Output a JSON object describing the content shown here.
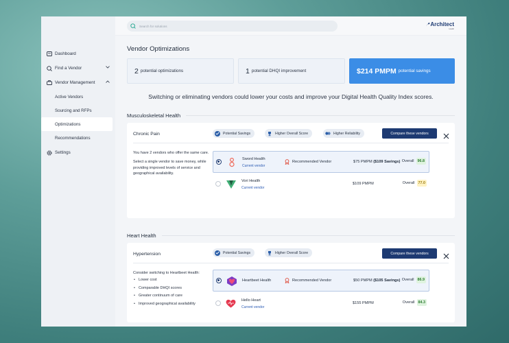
{
  "sidebar": {
    "items": [
      {
        "label": "Dashboard",
        "icon": "dashboard-icon"
      },
      {
        "label": "Find a Vendor",
        "icon": "search-icon"
      },
      {
        "label": "Vendor Management",
        "icon": "briefcase-icon"
      }
    ],
    "sub_items": [
      "Active Vendors",
      "Sourcing and RFPs",
      "Optimizations",
      "Recommendations"
    ],
    "settings_label": "Settings",
    "active_item": "Optimizations"
  },
  "topbar": {
    "search_placeholder": "Search for solutions",
    "logo_text": "Architect",
    "logo_sub": "Health"
  },
  "page": {
    "title": "Vendor Optimizations",
    "stats": [
      {
        "num": "2",
        "label": "potential optimizations"
      },
      {
        "num": "1",
        "label": "potential DHQI improvement"
      },
      {
        "num": "$214 PMPM",
        "label": "potential savings"
      }
    ],
    "subtitle": "Switching or eliminating vendors could lower your costs and improve your Digital Health Quality Index scores."
  },
  "sections": [
    {
      "heading": "Musculoskeletal Health",
      "card": {
        "title": "Chronic Pain",
        "chips": [
          "Potential Savings",
          "Higher Overall Score",
          "Higher Reliability"
        ],
        "compare_label": "Compare these vendors",
        "desc": [
          "You have 2 vendors who offer the same care.",
          "Select a single vendor to save money, while providing improved levels of service and geographical availability."
        ],
        "vendors": [
          {
            "name": "Sword Health",
            "current": "Current vendor",
            "recommended": "Recommended Vendor",
            "price": "$75 PMPM",
            "savings": "($109 Savings)",
            "overall_label": "Overall",
            "score": "96.8"
          },
          {
            "name": "Vori Health",
            "current": "Current vendor",
            "price": "$109 PMPM",
            "overall_label": "Overall",
            "score": "77.0"
          }
        ]
      }
    },
    {
      "heading": "Heart Health",
      "card": {
        "title": "Hypertension",
        "chips": [
          "Potential Savings",
          "Higher Overall Score"
        ],
        "compare_label": "Compare these vendors",
        "desc_intro": "Consider switching to Heartbeet Health:",
        "bullets": [
          "Lower cost",
          "Comparable DHQI scores",
          "Greater continuum of care",
          "Improved geographical availability"
        ],
        "vendors": [
          {
            "name": "Heartbeet Health",
            "recommended": "Recommended Vendor",
            "price": "$50 PMPM",
            "savings": "($105 Savings)",
            "overall_label": "Overall",
            "score": "86.9"
          },
          {
            "name": "Hello Heart",
            "current": "Current vendor",
            "price": "$155 PMPM",
            "overall_label": "Overall",
            "score": "84.3"
          }
        ]
      }
    }
  ],
  "colors": {
    "accent": "#3b8de6",
    "navy": "#1d3a72",
    "score_good": "#2e7d32",
    "score_mid": "#9a7a10"
  }
}
